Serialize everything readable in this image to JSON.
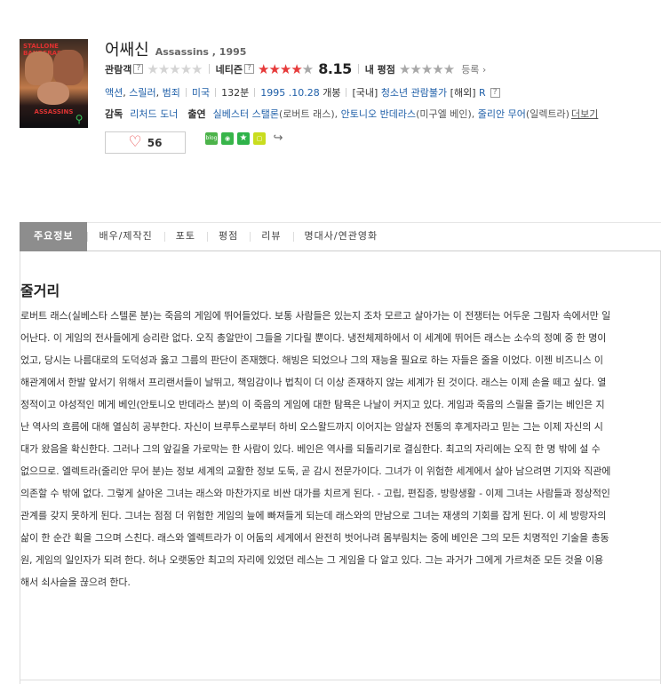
{
  "movie": {
    "title_ko": "어쌔신",
    "title_en_year": "Assassins , 1995"
  },
  "poster": {
    "title_text": "STALLONE  BANDERAS",
    "name_text": "ASSASSINS"
  },
  "ratings": {
    "audience_label": "관람객",
    "netizen_label": "네티즌",
    "netizen_score": "8.15",
    "my_rating_label": "내 평점",
    "register_label": "등록",
    "help_glyph": "?",
    "netizen_stars_filled": 4,
    "colors": {
      "star_red": "#e63a3a",
      "star_empty": "#d4d4d4",
      "link": "#1f5fa8"
    }
  },
  "info": {
    "genre1": "액션",
    "genre2": "스릴러",
    "genre3": "범죄",
    "country": "미국",
    "runtime": "132분",
    "release_date": "1995 .10.28",
    "release_suffix": "개봉",
    "domestic_label": "[국내]",
    "domestic_rating": "청소년 관람불가",
    "overseas_label": "[해외]",
    "overseas_rating": "R"
  },
  "crew": {
    "director_label": "감독",
    "director": "리처드 도너",
    "cast_label": "출연",
    "cast": [
      {
        "name": "실베스터 스탤론",
        "role": "(로버트 래스)"
      },
      {
        "name": "안토니오 반데라스",
        "role": "(미구엘 베인)"
      },
      {
        "name": "줄리안 무어",
        "role": "(일렉트라)"
      }
    ],
    "more": "더보기"
  },
  "like": {
    "count": "56"
  },
  "share": {
    "blog": "blog",
    "cafe": "cafe",
    "me2day": "me"
  },
  "tabs": [
    "주요정보",
    "배우/제작진",
    "포토",
    "평점",
    "리뷰",
    "명대사/연관영화"
  ],
  "story": {
    "heading": "줄거리",
    "text": "로버트 래스(실베스타 스텔론 분)는 죽음의 게임에 뛰어들었다. 보통 사람들은 있는지 조차 모르고 살아가는 이 전쟁터는 어두운 그림자 속에서만 일어난다. 이 게임의 전사들에게 승리란 없다. 오직 총알만이 그들을 기다릴 뿐이다. 냉전체제하에서 이 세계에 뛰어든 래스는 소수의 정예 중 한 명이었고, 당시는 나름대로의 도덕성과 옳고 그름의 판단이 존재했다. 해빙은 되었으나 그의 재능을 필요로 하는 자들은 줄을 이었다. 이젠 비즈니스 이해관계에서 한발 앞서기 위해서 프리랜서들이 날뛰고, 책임감이나 법칙이 더 이상 존재하지 않는 세계가 된 것이다. 래스는 이제 손을 떼고 싶다. 열정적이고 야성적인 메게 베인(안토니오 반데라스 분)의 이 죽음의 게임에 대한 탐욕은 나날이 커지고 있다. 게임과 죽음의 스릴을 즐기는 베인은 지난 역사의 흐름에 대해 열심히 공부한다. 자신이 브루투스로부터 하비 오스왈드까지 이어지는 암살자 전통의 후계자라고 믿는 그는 이제 자신의 시대가 왔음을 확신한다. 그러나 그의 앞길을 가로막는 한 사람이 있다. 베인은 역사를 되돌리기로 결심한다. 최고의 자리에는 오직 한 명 밖에 설 수 없으므로. 엘렉트라(줄리안 무어 분)는 정보 세계의 교활한 정보 도둑, 곧 감시 전문가이다. 그녀가 이 위험한 세계에서 살아 남으려면 기지와 직관에 의존할 수 밖에 없다. 그렇게 살아온 그녀는 래스와 마찬가지로 비싼 대가를 치르게 된다. - 고립, 편집증, 방랑생활 - 이제 그녀는 사람들과 정상적인 관계를 갖지 못하게 된다. 그녀는 점점 더 위험한 게임의 늪에 빠져들게 되는데 래스와의 만남으로 그녀는 재생의 기회를 잡게 된다. 이 세 방랑자의 삶이 한 순간 획을 그으며 스친다. 래스와 엘렉트라가 이 어둠의 세계에서 완전히 벗어나려 몸부림치는 중에 베인은 그의 모든 치명적인 기술을 총동원, 게임의 일인자가 되려 한다. 허나 오랫동안 최고의 자리에 있었던 레스는 그 게임을 다 알고 있다. 그는 과거가 그에게 가르쳐준 모든 것을 이용해서 쇠사슬을 끊으려 한다."
  }
}
